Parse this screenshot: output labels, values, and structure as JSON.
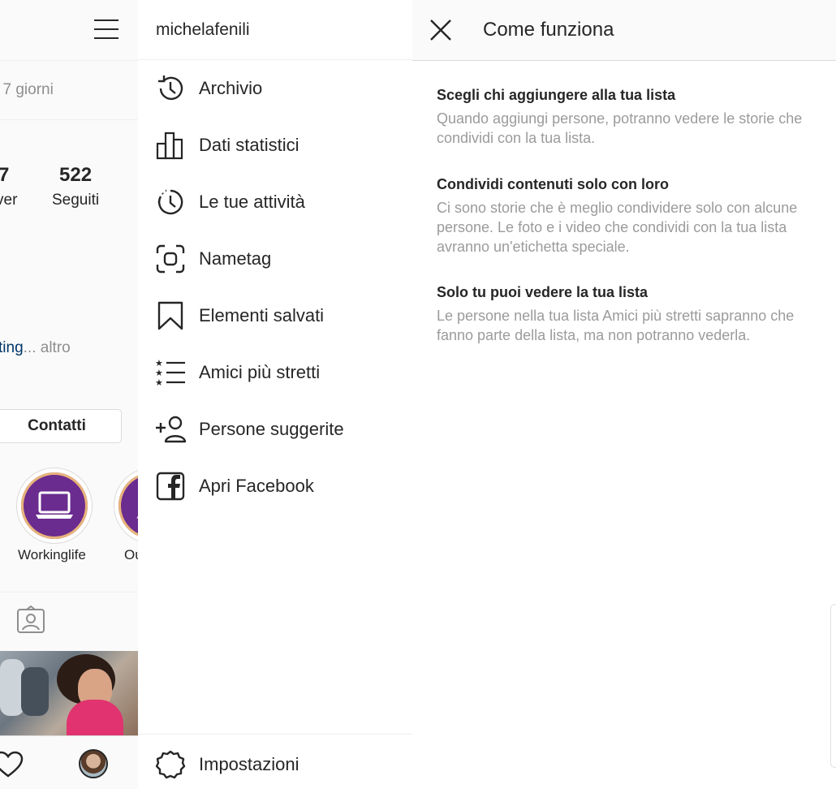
{
  "profile": {
    "days_text": "i 7 giorni",
    "stats": [
      {
        "num": "7",
        "label": "ver"
      },
      {
        "num": "522",
        "label": "Seguiti"
      }
    ],
    "bio_link": "ting",
    "bio_ellipsis": "...",
    "bio_more": " altro",
    "contact_button": "Contatti",
    "highlights": [
      {
        "label": "Workinglife",
        "icon": "laptop-icon"
      },
      {
        "label": "Ou",
        "icon": "triangle-icon"
      }
    ]
  },
  "drawer": {
    "username": "michelafenili",
    "items": [
      {
        "label": "Archivio",
        "icon": "archive-clock-icon"
      },
      {
        "label": "Dati statistici",
        "icon": "bar-chart-icon"
      },
      {
        "label": "Le tue attività",
        "icon": "activity-clock-icon"
      },
      {
        "label": "Nametag",
        "icon": "nametag-scan-icon"
      },
      {
        "label": "Elementi salvati",
        "icon": "bookmark-icon"
      },
      {
        "label": "Amici più stretti",
        "icon": "close-friends-list-icon"
      },
      {
        "label": "Persone suggerite",
        "icon": "add-person-icon"
      },
      {
        "label": "Apri Facebook",
        "icon": "facebook-icon"
      }
    ],
    "settings_label": "Impostazioni"
  },
  "info": {
    "title": "Come funziona",
    "sections": [
      {
        "title": "Scegli chi aggiungere alla tua lista",
        "body": "Quando aggiungi persone, potranno vedere le storie che condividi con la tua lista."
      },
      {
        "title": "Condividi contenuti solo con loro",
        "body": "Ci sono storie che è meglio condividere solo con alcune persone. Le foto e i video che condividi con la tua lista avranno un'etichetta speciale."
      },
      {
        "title": "Solo tu puoi vedere la tua lista",
        "body": "Le persone nella tua lista Amici più stretti sapranno che fanno parte della lista, ma non potranno vederla."
      }
    ]
  },
  "colors": {
    "text": "#262626",
    "secondary": "#8e8e8e",
    "link": "#003569",
    "highlight_purple": "#6a2c8e",
    "divider": "#efefef"
  }
}
